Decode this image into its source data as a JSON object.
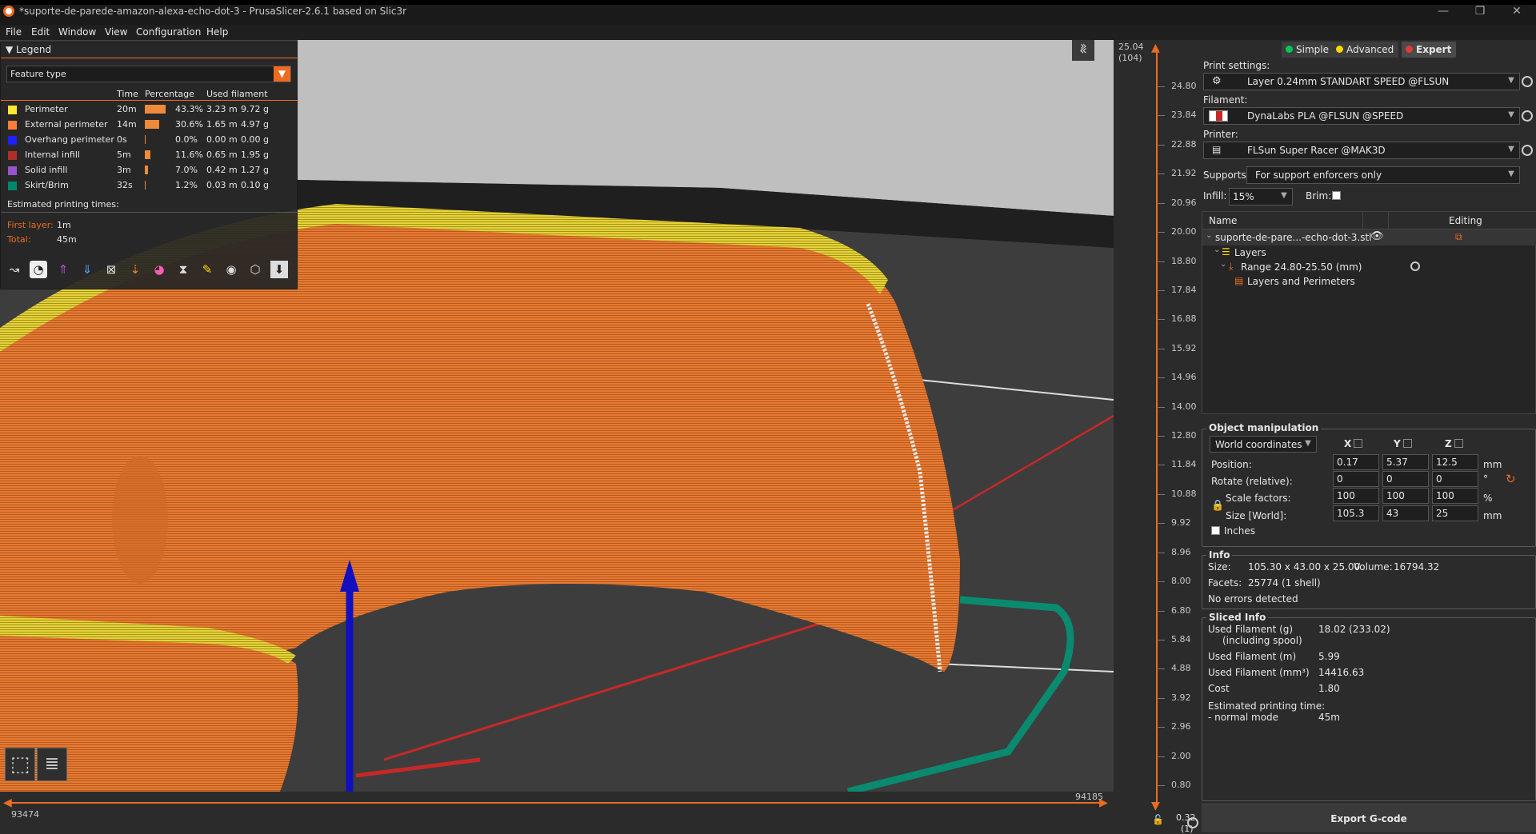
{
  "window": {
    "title": "*suporte-de-parede-amazon-alexa-echo-dot-3 - PrusaSlicer-2.6.1 based on Slic3r",
    "minimize": "—",
    "restore": "❐",
    "close": "✕"
  },
  "menu": [
    "File",
    "Edit",
    "Window",
    "View",
    "Configuration",
    "Help"
  ],
  "legend": {
    "title": "Legend",
    "feature_combo": "Feature type",
    "columns": {
      "time": "Time",
      "percentage": "Percentage",
      "used_filament": "Used filament"
    },
    "rows": [
      {
        "name": "Perimeter",
        "color": "#ffe833",
        "time": "20m",
        "pct": "43.3%",
        "pct_value": 0.433,
        "m": "3.23 m",
        "g": "9.72 g"
      },
      {
        "name": "External perimeter",
        "color": "#ff7d38",
        "time": "14m",
        "pct": "30.6%",
        "pct_value": 0.306,
        "m": "1.65 m",
        "g": "4.97 g"
      },
      {
        "name": "Overhang perimeter",
        "color": "#1f1fff",
        "time": "0s",
        "pct": "0.0%",
        "pct_value": 0.0,
        "m": "0.00 m",
        "g": "0.00 g"
      },
      {
        "name": "Internal infill",
        "color": "#b03029",
        "time": "5m",
        "pct": "11.6%",
        "pct_value": 0.116,
        "m": "0.65 m",
        "g": "1.95 g"
      },
      {
        "name": "Solid infill",
        "color": "#9654cc",
        "time": "3m",
        "pct": "7.0%",
        "pct_value": 0.07,
        "m": "0.42 m",
        "g": "1.27 g"
      },
      {
        "name": "Skirt/Brim",
        "color": "#00876e",
        "time": "32s",
        "pct": "1.2%",
        "pct_value": 0.012,
        "m": "0.03 m",
        "g": "0.10 g"
      }
    ],
    "estimated": "Estimated printing times:",
    "first_layer_label": "First layer:",
    "first_layer_value": "1m",
    "total_label": "Total:",
    "total_value": "45m"
  },
  "hslider": {
    "left_value": "93474",
    "right_value": "94185"
  },
  "vslider": {
    "top_value": "25.04",
    "top_layer": "(104)",
    "bottom_value": "0.32",
    "bottom_layer": "(1)",
    "ticks": [
      "24.80",
      "23.84",
      "22.88",
      "21.92",
      "20.96",
      "20.00",
      "18.80",
      "17.84",
      "16.88",
      "15.92",
      "14.96",
      "14.00",
      "12.80",
      "11.84",
      "10.88",
      "9.92",
      "8.96",
      "8.00",
      "6.80",
      "5.84",
      "4.88",
      "3.92",
      "2.96",
      "2.00",
      "0.80"
    ]
  },
  "modes": [
    {
      "label": "Simple",
      "color": "#00c853"
    },
    {
      "label": "Advanced",
      "color": "#ffd600"
    },
    {
      "label": "Expert",
      "color": "#e53935"
    }
  ],
  "print_settings": {
    "label": "Print settings:",
    "value": "Layer 0.24mm STANDART SPEED @FLSUN"
  },
  "filament": {
    "label": "Filament:",
    "value": "DynaLabs PLA @FLSUN @SPEED",
    "color": "#c62828"
  },
  "printer": {
    "label": "Printer:",
    "value": "FLSun Super Racer @MAK3D"
  },
  "supports": {
    "label": "Supports:",
    "value": "For support enforcers only"
  },
  "infill": {
    "label": "Infill:",
    "value": "15%"
  },
  "brim": {
    "label": "Brim:"
  },
  "object_list": {
    "col_name": "Name",
    "col_editing": "Editing",
    "object": "suporte-de-pare...-echo-dot-3.stl",
    "layers": "Layers",
    "range": "Range 24.80-25.50 (mm)",
    "layers_perimeters": "Layers and Perimeters"
  },
  "manipulation": {
    "title": "Object manipulation",
    "coords": "World coordinates",
    "x": "X",
    "y": "Y",
    "z": "Z",
    "position_label": "Position:",
    "position": [
      "0.17",
      "5.37",
      "12.5"
    ],
    "position_unit": "mm",
    "rotate_label": "Rotate (relative):",
    "rotate": [
      "0",
      "0",
      "0"
    ],
    "rotate_unit": "°",
    "scale_label": "Scale factors:",
    "scale": [
      "100",
      "100",
      "100"
    ],
    "scale_unit": "%",
    "size_label": "Size [World]:",
    "size": [
      "105.3",
      "43",
      "25"
    ],
    "size_unit": "mm",
    "inches": "Inches"
  },
  "info": {
    "title": "Info",
    "size_label": "Size:",
    "size_value": "105.30 x 43.00 x 25.00",
    "volume_label": "Volume:",
    "volume_value": "16794.32",
    "facets_label": "Facets:",
    "facets_value": "25774 (1 shell)",
    "errors": "No errors detected"
  },
  "sliced": {
    "title": "Sliced Info",
    "g_label": "Used Filament (g)",
    "g_sub": "(including spool)",
    "g_value": "18.02 (233.02)",
    "m_label": "Used Filament (m)",
    "m_value": "5.99",
    "mm3_label": "Used Filament (mm³)",
    "mm3_value": "14416.63",
    "cost_label": "Cost",
    "cost_value": "1.80",
    "time_label": "Estimated printing time:",
    "time_mode": "- normal mode",
    "time_value": "45m"
  },
  "export_button": "Export G-code"
}
